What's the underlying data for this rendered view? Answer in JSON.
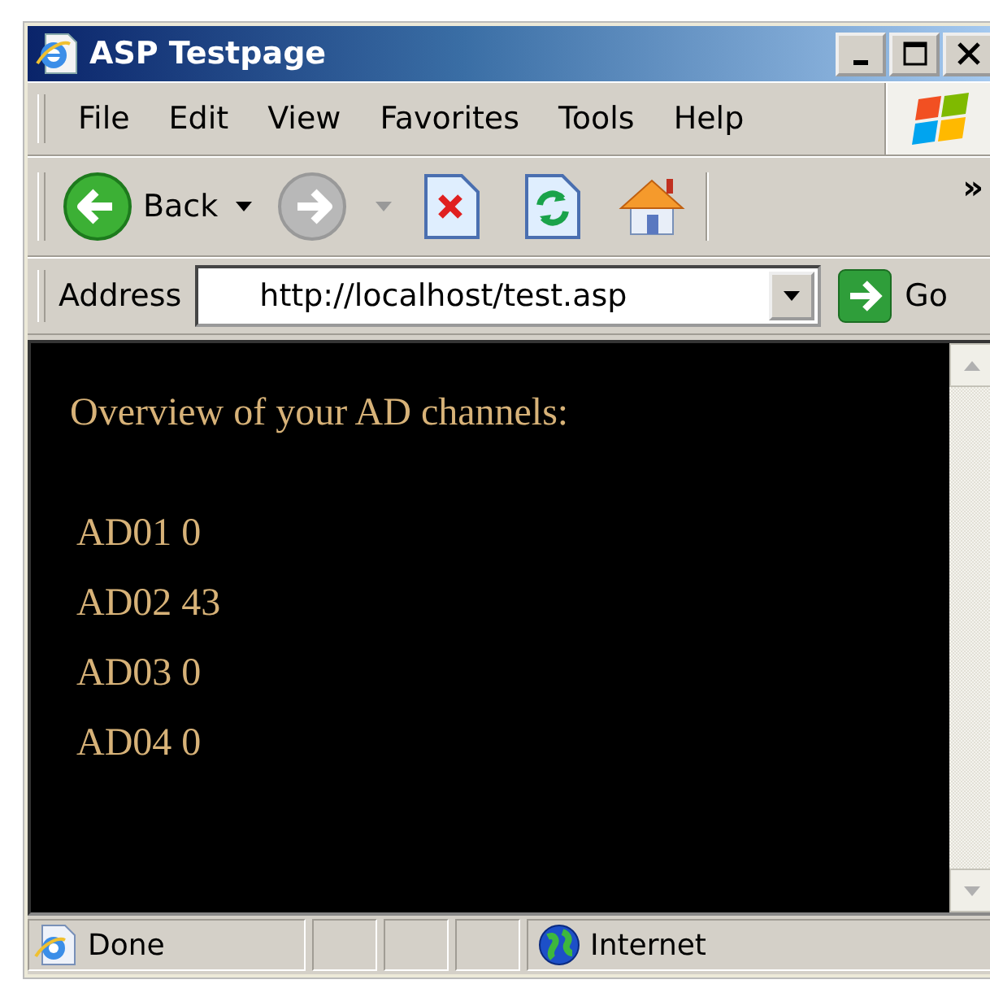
{
  "window": {
    "title": "ASP Testpage"
  },
  "menu": [
    "File",
    "Edit",
    "View",
    "Favorites",
    "Tools",
    "Help"
  ],
  "toolbar": {
    "back": {
      "label": "Back",
      "disabled": false
    },
    "forward": {
      "disabled": true
    },
    "overflow": "»"
  },
  "address": {
    "label": "Address",
    "value": "http://localhost/test.asp",
    "go": "Go"
  },
  "page": {
    "heading": "Overview of your AD channels:",
    "lines": [
      "AD01 0",
      "AD02 43",
      "AD03 0",
      "AD04 0"
    ]
  },
  "status_bar": {
    "text": "Done",
    "zone": "Internet"
  }
}
